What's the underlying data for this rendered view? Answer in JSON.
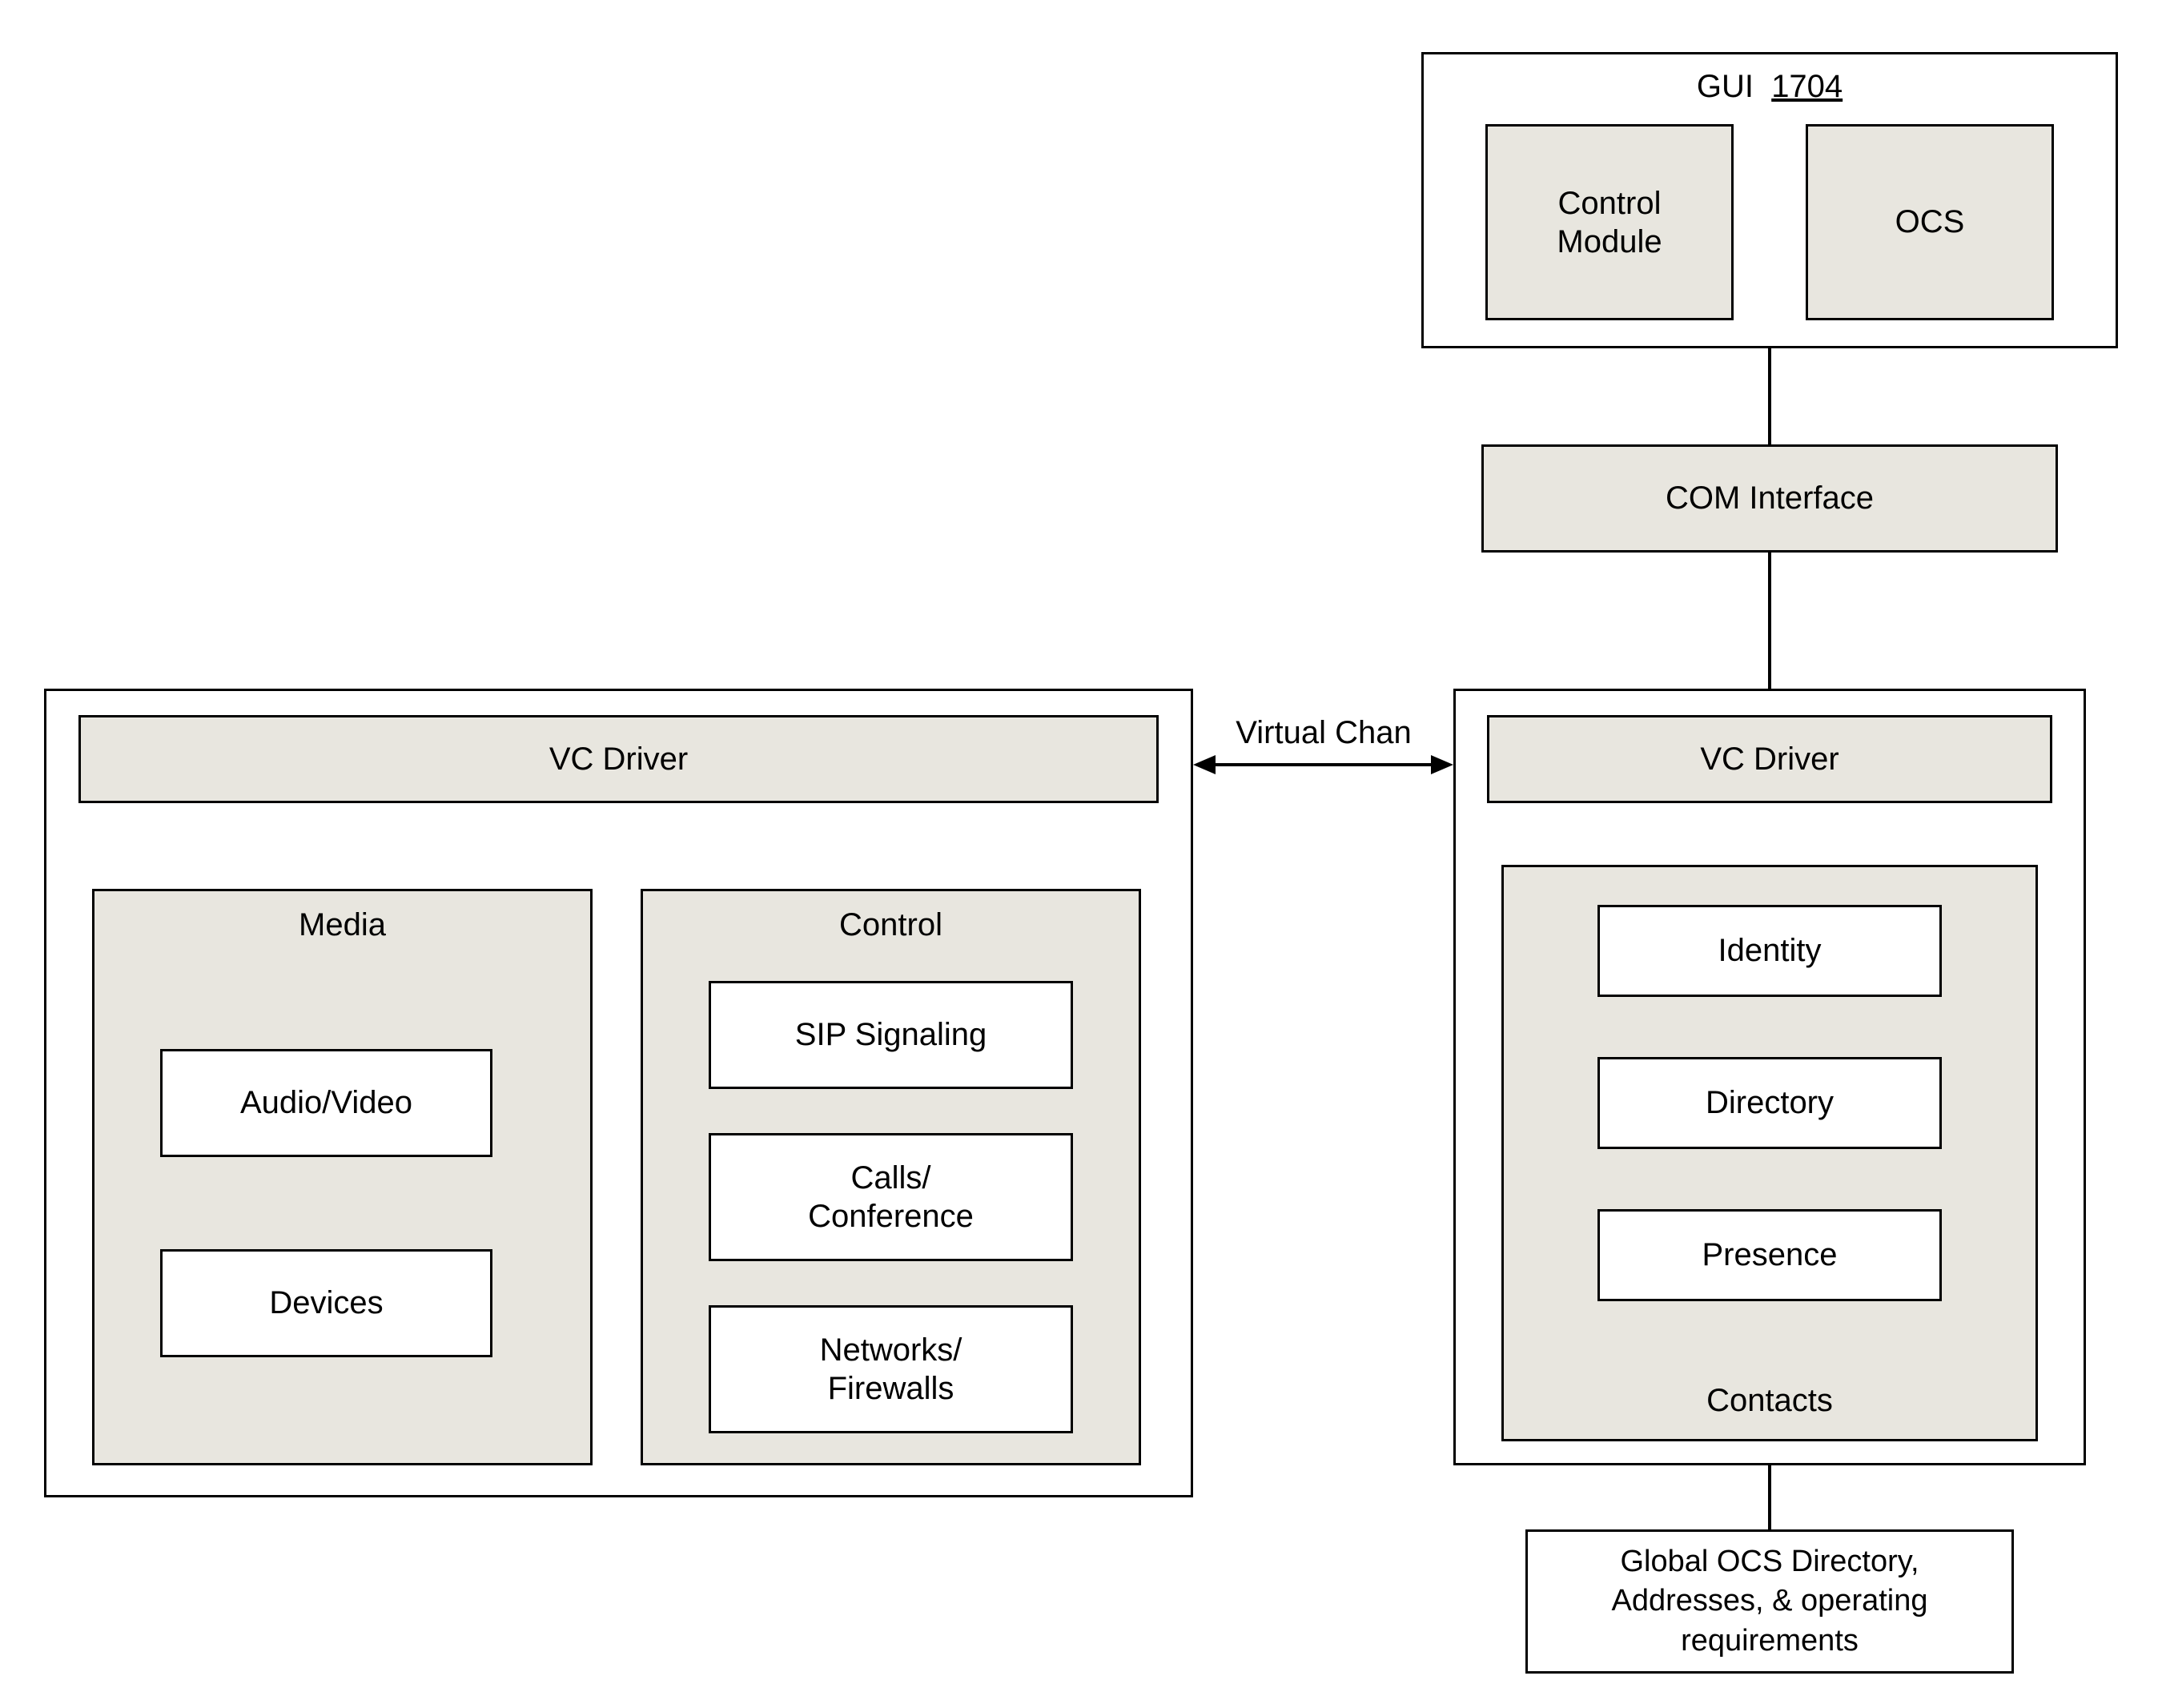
{
  "gui": {
    "title": "GUI",
    "number": "1704",
    "control_module": "Control\nModule",
    "ocs": "OCS"
  },
  "com_interface": "COM Interface",
  "virtual_chan": "Virtual Chan",
  "left": {
    "vc_driver": "VC Driver",
    "media": {
      "title": "Media",
      "audio_video": "Audio/Video",
      "devices": "Devices"
    },
    "control": {
      "title": "Control",
      "sip_signaling": "SIP Signaling",
      "calls_conference": "Calls/\nConference",
      "networks_firewalls": "Networks/\nFirewalls"
    }
  },
  "right": {
    "vc_driver": "VC Driver",
    "contacts": {
      "title": "Contacts",
      "identity": "Identity",
      "directory": "Directory",
      "presence": "Presence"
    }
  },
  "global_ocs": "Global OCS Directory,\nAddresses, & operating\nrequirements"
}
